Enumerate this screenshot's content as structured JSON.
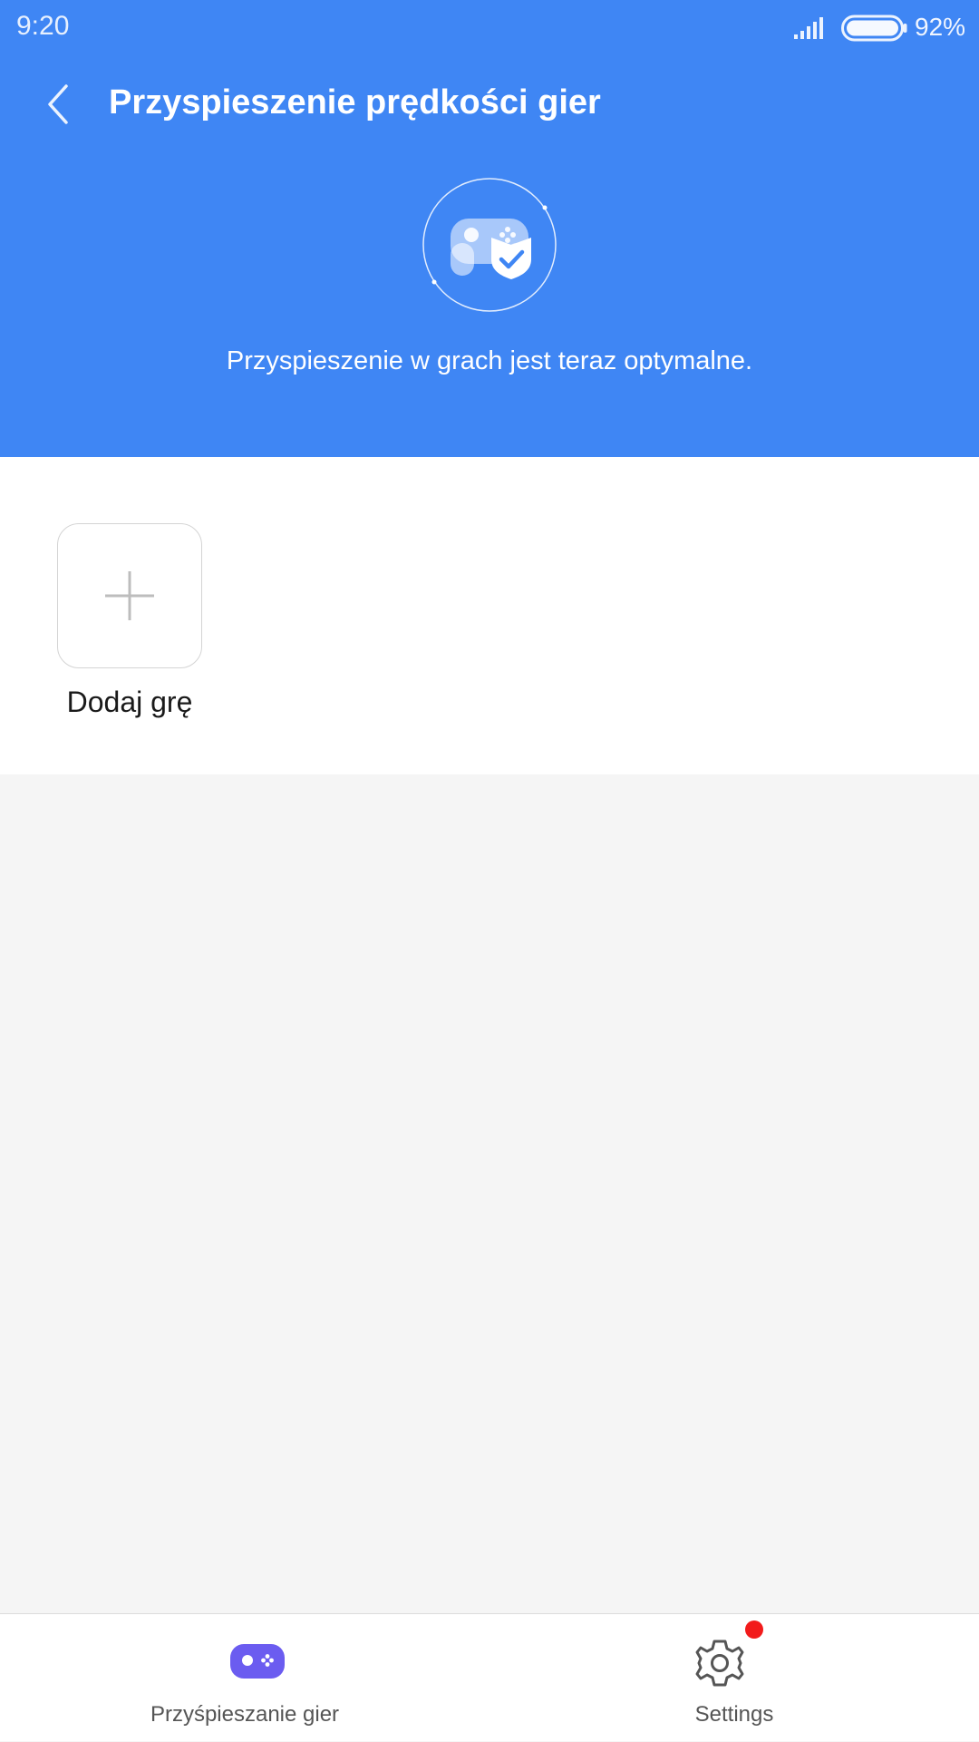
{
  "status_bar": {
    "time": "9:20",
    "signal_icon": "cellular-signal-icon",
    "battery_icon": "battery-icon",
    "battery_percent": "92%",
    "battery_level": 0.92
  },
  "header": {
    "back_icon": "chevron-left-icon",
    "title": "Przyspieszenie prędkości gier",
    "hero_icon": "gamepad-shield-check-icon",
    "status_text": "Przyspieszenie w grach jest teraz optymalne."
  },
  "games": {
    "add_tile_icon": "plus-icon",
    "add_label": "Dodaj grę"
  },
  "bottom_nav": {
    "items": [
      {
        "label": "Przyśpieszanie gier",
        "icon": "gamepad-icon",
        "active": true
      },
      {
        "label": "Settings",
        "icon": "gear-icon",
        "has_notification": true
      }
    ]
  },
  "colors": {
    "header_bg": "#3f86f4",
    "active_icon": "#6b5cf0",
    "notification": "#f21b1b",
    "content_bg": "#f5f5f5"
  }
}
